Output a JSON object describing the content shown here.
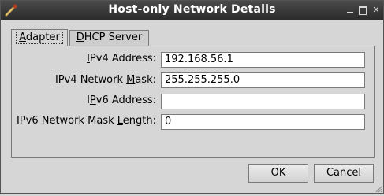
{
  "window": {
    "title": "Host-only Network Details"
  },
  "tabs": [
    {
      "label_underline": "A",
      "label_rest": "dapter",
      "selected": true
    },
    {
      "label_underline": "D",
      "label_rest": "HCP Server",
      "selected": false
    }
  ],
  "fields": {
    "ipv4_address": {
      "label_pre": "",
      "label_ul": "I",
      "label_post": "Pv4 Address:",
      "value": "192.168.56.1"
    },
    "ipv4_mask": {
      "label_pre": "IPv4 Network ",
      "label_ul": "M",
      "label_post": "ask:",
      "value": "255.255.255.0"
    },
    "ipv6_address": {
      "label_pre": "I",
      "label_ul": "P",
      "label_post": "v6 Address:",
      "value": ""
    },
    "ipv6_mask_length": {
      "label_pre": "IPv6 Network Mask ",
      "label_ul": "L",
      "label_post": "ength:",
      "value": "0"
    }
  },
  "buttons": {
    "ok": "OK",
    "cancel": "Cancel"
  },
  "icons": {
    "app": "virtualbox-tool-icon",
    "minimize": "minimize-icon",
    "maximize": "maximize-icon",
    "close": "close-icon"
  }
}
